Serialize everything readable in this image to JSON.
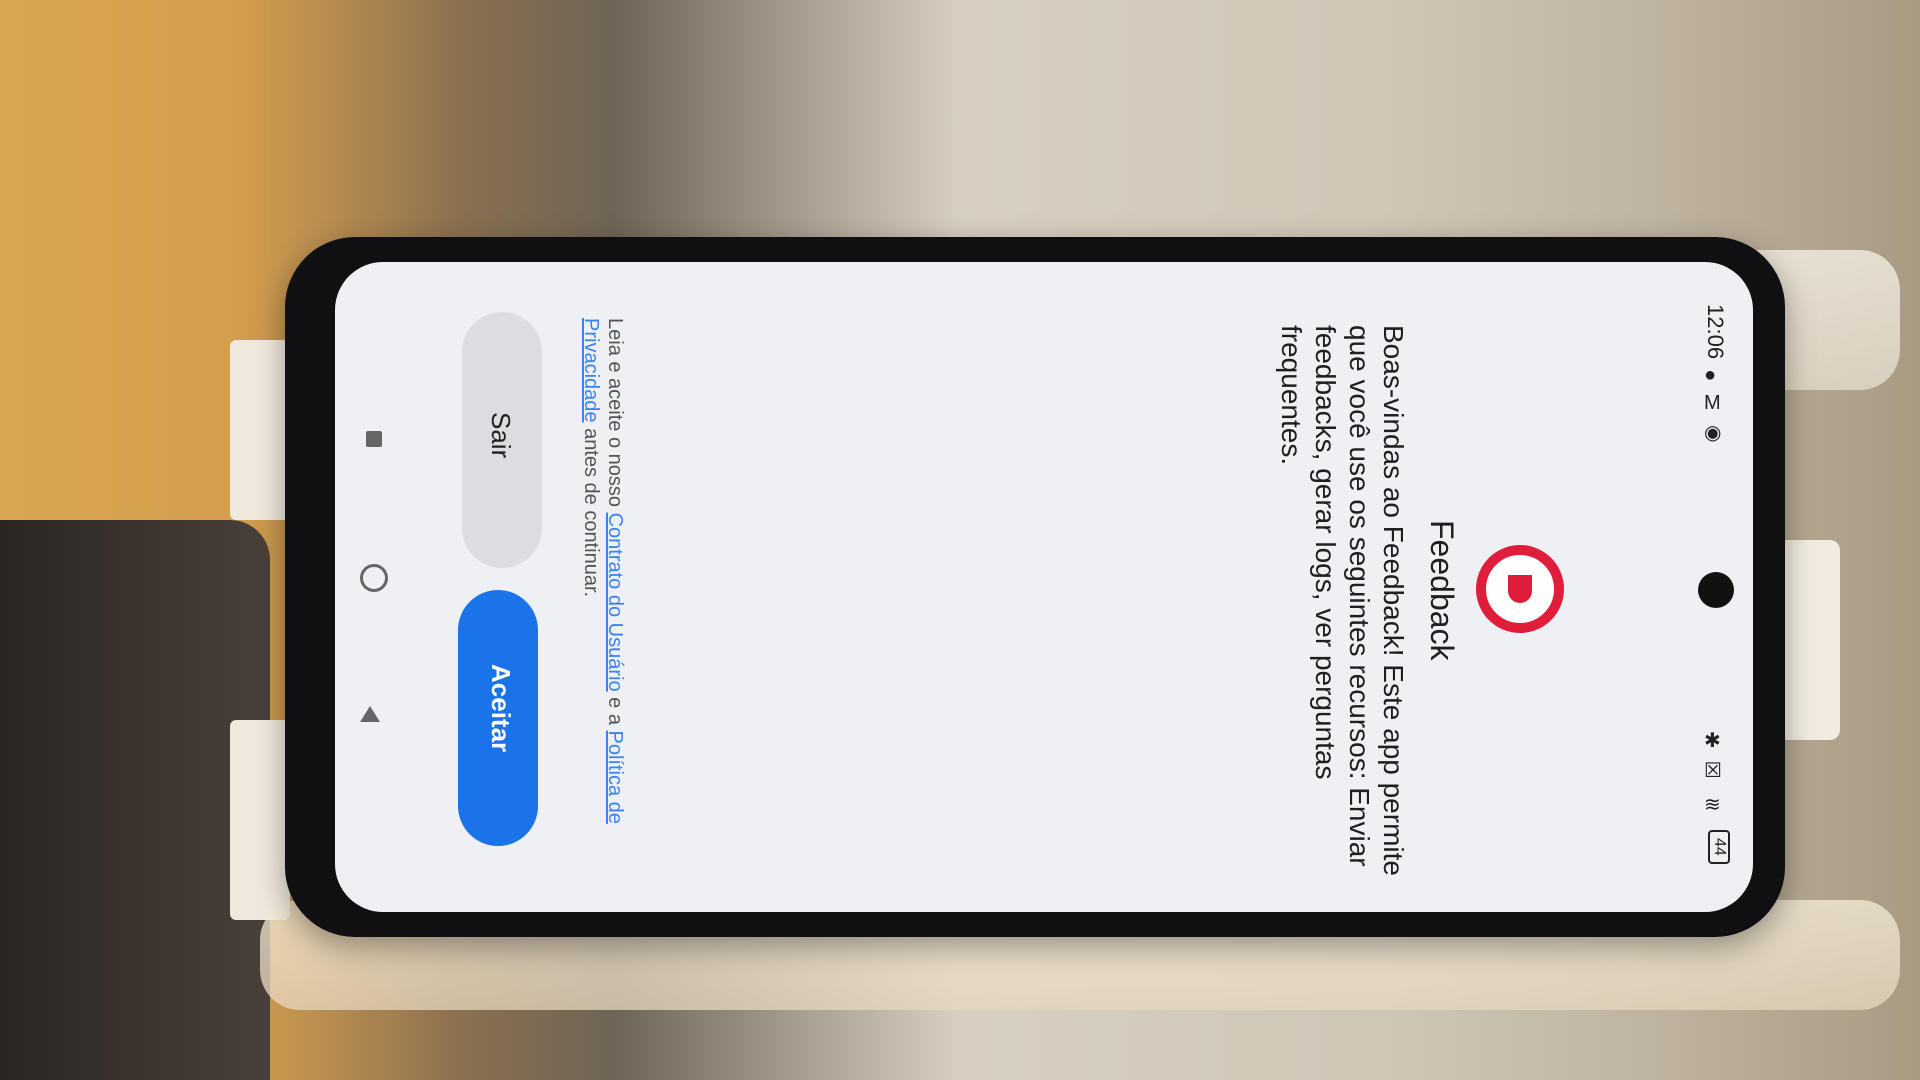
{
  "status_bar": {
    "time": "12:06",
    "icons_left": [
      "notification-icon",
      "gmail-icon",
      "check-circle-icon"
    ],
    "icons_right": [
      "bluetooth-icon",
      "sim-off-icon",
      "wifi-icon",
      "battery-icon"
    ],
    "battery_level": "44"
  },
  "app": {
    "title": "Feedback",
    "logo_color": "#e11d3c",
    "welcome_text": "Boas-vindas ao Feedback! Este app permite que você use os seguintes recursos: Enviar feedbacks, gerar logs, ver perguntas frequentes."
  },
  "legal": {
    "prefix": "Leia e aceite o nosso ",
    "user_agreement_link": "Contrato do Usuário",
    "conjunction": " e a ",
    "privacy_policy_link": "Política de Privacidade",
    "suffix": " antes de continuar."
  },
  "buttons": {
    "exit_label": "Sair",
    "accept_label": "Aceitar",
    "accept_color": "#1a73e8"
  },
  "nav_bar": {
    "icons": [
      "recents-icon",
      "home-icon",
      "back-icon"
    ]
  }
}
